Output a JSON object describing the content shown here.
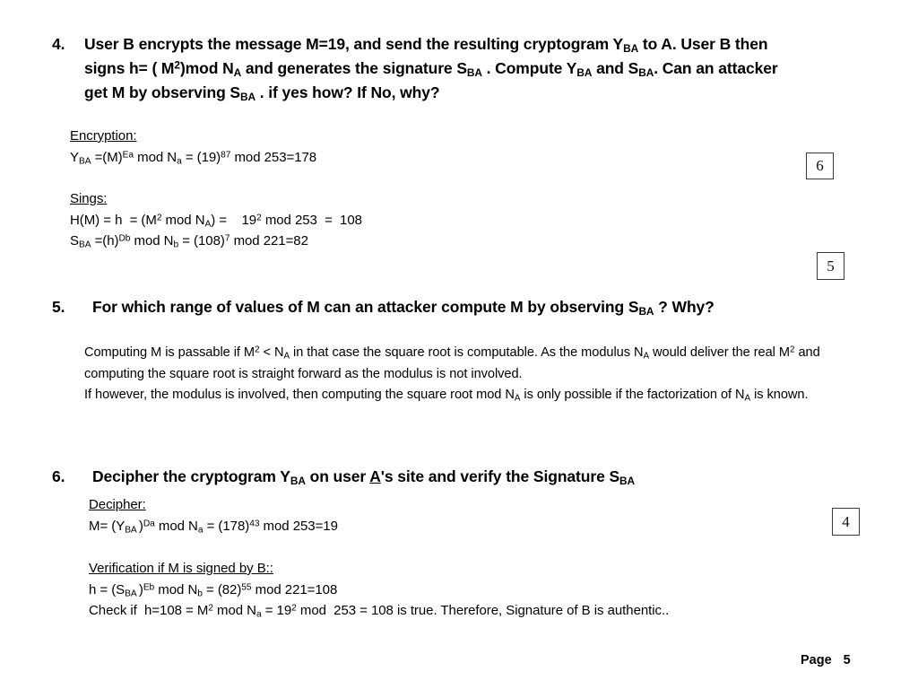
{
  "document": {
    "type": "lecture-slide-solution",
    "footer": {
      "label": "Page",
      "number": "5"
    }
  },
  "questions": {
    "q4": {
      "number": "4.",
      "text_parts": {
        "p1": "User B encrypts the message  M=19, and send the resulting cryptogram  Y",
        "s1": "BA",
        "p2": " to A. User B then signs h= ( M",
        "sup1": "2",
        "p3": ")mod N",
        "s2": "A",
        "p4": "  and generates the signature S",
        "s3": "BA",
        "p5": " . Compute Y",
        "s4": "BA",
        "p6": " and S",
        "s5": "BA",
        "p7": ". Can an attacker get M by observing S",
        "s6": "BA",
        "p8": " . if yes how? If No, why?"
      }
    },
    "q5": {
      "number": "5.",
      "text_parts": {
        "p1": "For which range of values of M can an attacker compute M by observing S",
        "s1": "BA",
        "p2": " ? Why?"
      }
    },
    "q6": {
      "number": "6.",
      "text_parts": {
        "p1": "Decipher the cryptogram Y",
        "s1": "BA",
        "p2": " on user ",
        "underlined": "A",
        "p3": "'s site and verify the Signature  S",
        "s2": "BA"
      }
    }
  },
  "encryption": {
    "heading": "Encryption:",
    "line1": {
      "a": "Y",
      "sub_a": "BA",
      "b": " =(M)",
      "sup_b": "Ea",
      "c": " mod N",
      "sub_c": "a",
      "d": " = (19)",
      "sup_d": "87",
      "e": " mod 253=178"
    }
  },
  "signing": {
    "heading": "Sings:",
    "line1": {
      "a": "H(M) = h  = (M",
      "sup_a": "2",
      "b": " mod N",
      "sub_b": "A",
      "c": ") =    19",
      "sup_c": "2",
      "d": " mod 253  =  108"
    },
    "line2": {
      "a": "S",
      "sub_a": "BA",
      "b": " =(h)",
      "sup_b": "Db",
      "c": " mod N",
      "sub_c": "b",
      "d": " = (108)",
      "sup_d": "7",
      "e": " mod 221=82"
    }
  },
  "answer5": {
    "para1": {
      "a": "Computing M  is passable if M",
      "sup_a": "2",
      "b": " < N",
      "sub_b": "A",
      "c": "  in that case the square root is computable. As the modulus N",
      "sub_c": "A",
      "d": " would deliver the real M",
      "sup_d": "2",
      "e": " and computing the square root is straight forward as the modulus is not involved."
    },
    "para2": {
      "a": "If however, the modulus is involved, then computing the square root mod N",
      "sub_a": "A",
      "b": " is only possible if the factorization of N",
      "sub_b": "A",
      "c": " is known."
    }
  },
  "decipher": {
    "heading": "Decipher:",
    "line1": {
      "a": "M= (Y",
      "sub_a": "BA ",
      "b": ")",
      "sup_b": "Da",
      "c": " mod N",
      "sub_c": "a",
      "d": " = (178)",
      "sup_d": "43",
      "e": " mod 253=19"
    }
  },
  "verification": {
    "heading": "Verification if M is signed by B::",
    "line1": {
      "a": "h = (S",
      "sub_a": "BA ",
      "b": ")",
      "sup_b": "Eb",
      "c": " mod N",
      "sub_c": "b",
      "d": " = (82)",
      "sup_d": "55",
      "e": " mod 221=108"
    },
    "line2": {
      "a": "Check if  h=108 = M",
      "sup_a": "2",
      "b": " mod N",
      "sub_b": "a",
      "c": " = 19",
      "sup_c": "2",
      "d": " mod  253 = 108 is true. Therefore, Signature of B is authentic.."
    }
  },
  "mark_boxes": [
    {
      "value": "6"
    },
    {
      "value": "5"
    },
    {
      "value": "4"
    }
  ]
}
